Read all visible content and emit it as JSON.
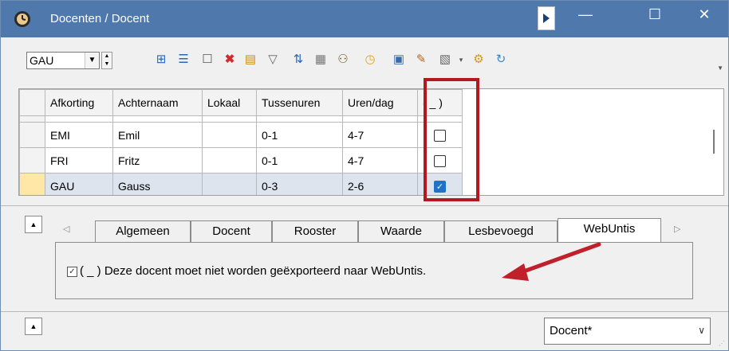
{
  "window": {
    "title": "Docenten / Docent",
    "controls": {
      "minimize": "—",
      "maximize": "☐",
      "close": "✕"
    }
  },
  "toolbar": {
    "selector_value": "GAU",
    "icons": [
      "grid-view-icon",
      "list-view-icon",
      "new-record-icon",
      "delete-icon",
      "report-icon",
      "filter-icon",
      "sort-icon",
      "settings-grid-icon",
      "users-icon",
      "clock-icon",
      "calendar-icon",
      "color-palette-icon",
      "page-settings-icon",
      "gear-icon",
      "refresh-icon"
    ]
  },
  "grid": {
    "columns": [
      "Afkorting",
      "Achternaam",
      "Lokaal",
      "Tussenuren",
      "Uren/dag",
      "( _ )"
    ],
    "rows": [
      {
        "afkorting": "EMI",
        "achternaam": "Emil",
        "lokaal": "",
        "tussenuren": "0-1",
        "uren_dag": "4-7",
        "checked": false,
        "selected": false
      },
      {
        "afkorting": "FRI",
        "achternaam": "Fritz",
        "lokaal": "",
        "tussenuren": "0-1",
        "uren_dag": "4-7",
        "checked": false,
        "selected": false
      },
      {
        "afkorting": "GAU",
        "achternaam": "Gauss",
        "lokaal": "",
        "tussenuren": "0-3",
        "uren_dag": "2-6",
        "checked": true,
        "selected": true
      }
    ]
  },
  "tabs": [
    "Algemeen",
    "Docent",
    "Rooster",
    "Waarde",
    "Lesbevoegd",
    "WebUntis"
  ],
  "active_tab": "WebUntis",
  "webuntis": {
    "checkbox_checked": true,
    "checkbox_label": "( _ ) Deze docent moet niet worden geëxporteerd naar WebUntis."
  },
  "footer": {
    "view_selected": "Docent*"
  },
  "colors": {
    "titlebar": "#4f78ac",
    "highlight_box": "#b3181e",
    "arrow": "#c0202a",
    "selected_row": "#dde4ee",
    "checkbox_checked": "#1e73c8"
  }
}
